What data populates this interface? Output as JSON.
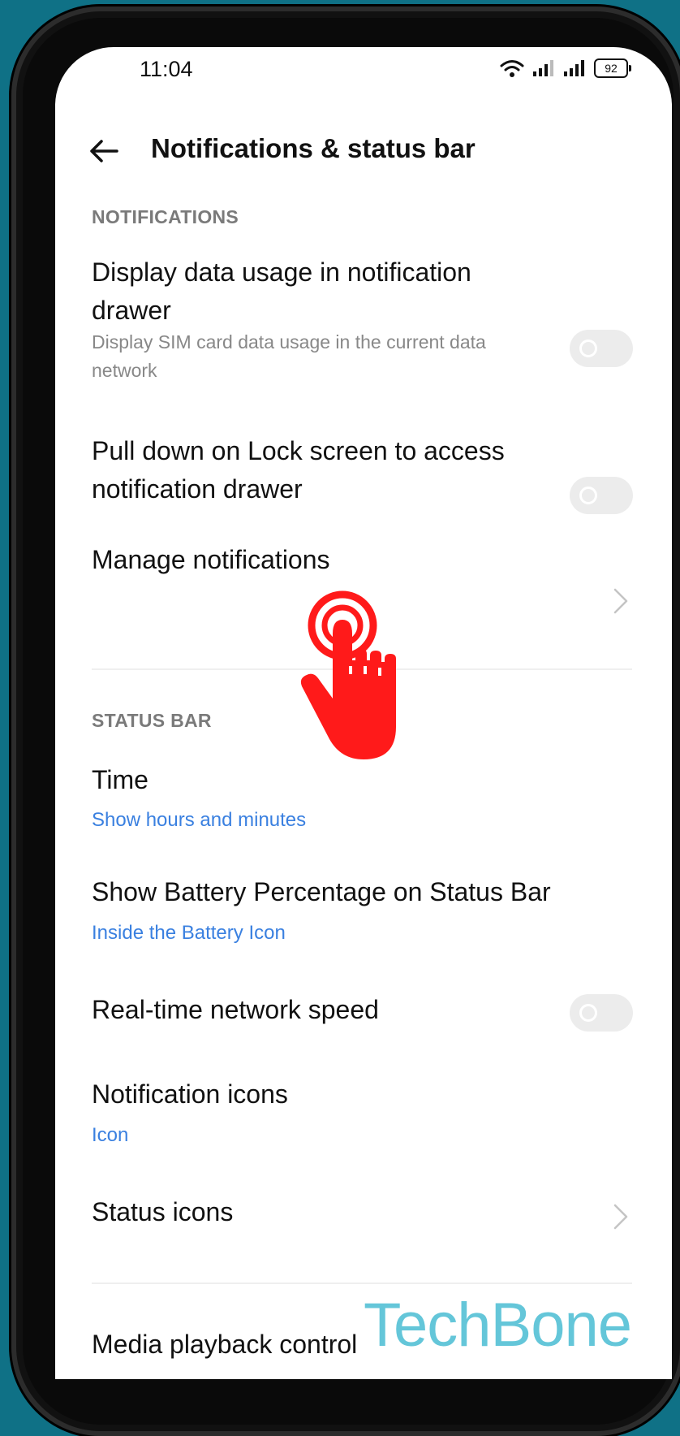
{
  "status_bar": {
    "time": "11:04",
    "battery": "92",
    "icons": [
      "wifi-icon",
      "signal-icon",
      "signal-icon",
      "battery-icon"
    ]
  },
  "header": {
    "title": "Notifications & status bar"
  },
  "sections": {
    "notifications": {
      "label": "NOTIFICATIONS",
      "items": [
        {
          "title_line1": "Display data usage in notification",
          "title_line2": "drawer",
          "sub_line1": "Display SIM card data usage in the current data",
          "sub_line2": "network",
          "toggle_on": false
        },
        {
          "title_line1": "Pull down on Lock screen to access",
          "title_line2": "notification drawer",
          "toggle_on": false
        },
        {
          "title": "Manage notifications"
        }
      ]
    },
    "status_bar": {
      "label": "STATUS BAR",
      "items": [
        {
          "title": "Time",
          "value": "Show hours and minutes"
        },
        {
          "title": "Show Battery Percentage on Status Bar",
          "value": "Inside the Battery Icon"
        },
        {
          "title": "Real-time network speed",
          "toggle_on": false
        },
        {
          "title": "Notification icons",
          "value": "Icon"
        },
        {
          "title": "Status icons"
        }
      ]
    },
    "media": {
      "items": [
        {
          "title": "Media playback control"
        }
      ]
    }
  },
  "watermark": "TechBone",
  "colors": {
    "background": "#0f7186",
    "accent_link": "#3a80e0",
    "tap_hand": "#ff1a1a",
    "watermark": "#5cc4d8"
  }
}
